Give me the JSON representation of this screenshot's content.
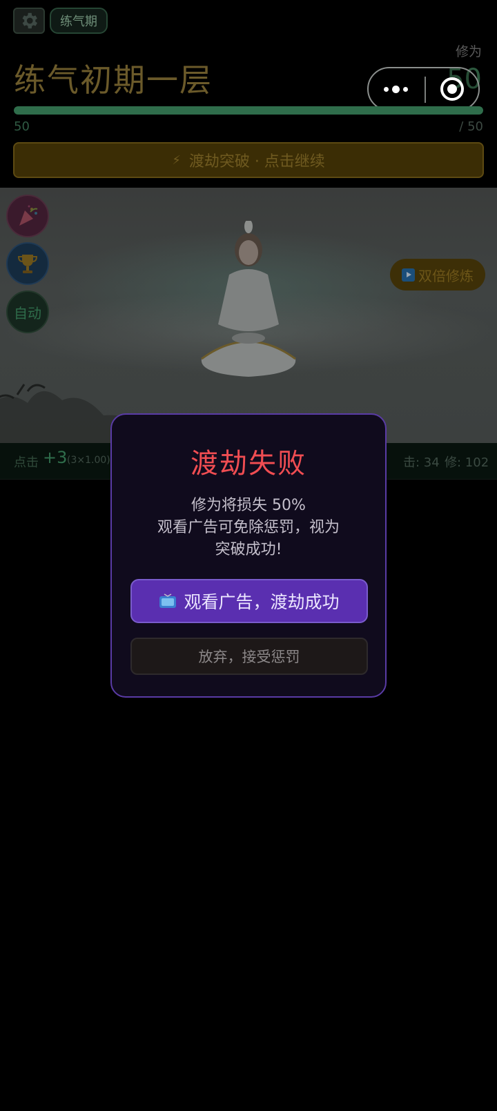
{
  "header": {
    "realm_pill": "练气期",
    "cultivation_label": "修为",
    "cultivation_value": "50",
    "realm_title": "练气初期一层"
  },
  "progress": {
    "current": "50",
    "max": "/ 50",
    "fraction": 1.0
  },
  "breakthrough": {
    "icon": "⚡",
    "label": "渡劫突破 · 点击继续"
  },
  "scene": {
    "side_buttons": [
      {
        "name": "party-popper-icon"
      },
      {
        "name": "trophy-icon"
      },
      {
        "label": "自动"
      }
    ],
    "double_label": "双倍修炼"
  },
  "stats": {
    "click_label": "点击",
    "click_amount": "+3",
    "click_multiplier": "(3×1.00)",
    "hits": "击: 34",
    "cultivation": "修: 102"
  },
  "modal": {
    "title": "渡劫失败",
    "line1": "修为将损失 50%",
    "line2": "观看广告可免除惩罚，视为",
    "line3": "突破成功!",
    "watch_label": "观看广告，渡劫成功",
    "giveup_label": "放弃，接受惩罚"
  },
  "colors": {
    "accent_green": "#2f6d4b",
    "gold": "#6b5a2a",
    "modal_border": "#5a3ba6",
    "danger_red": "#f04d52",
    "watch_purple": "#5a2fb0"
  }
}
